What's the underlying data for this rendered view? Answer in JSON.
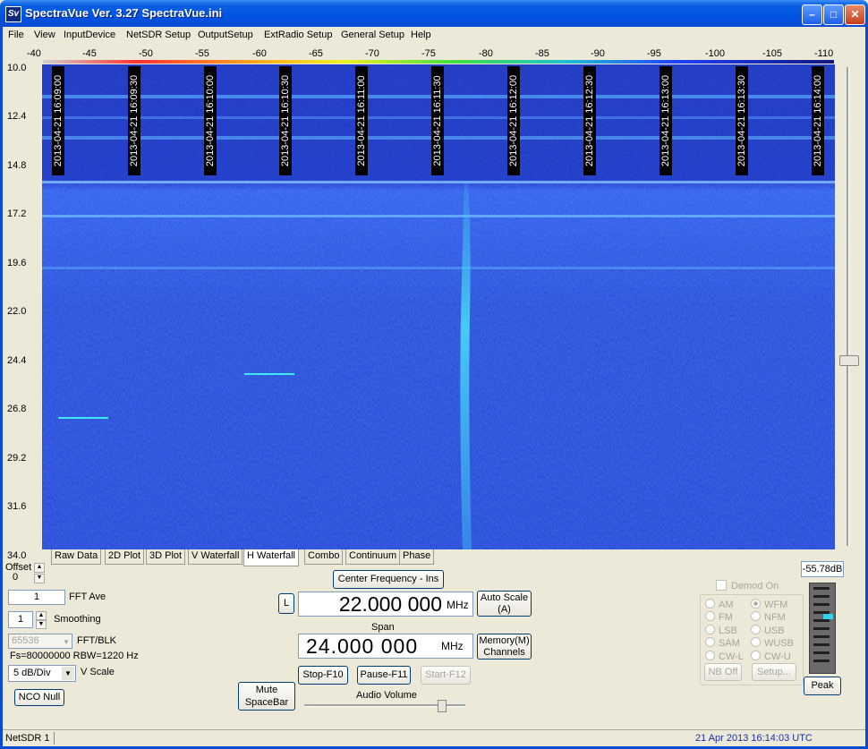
{
  "window": {
    "title": "SpectraVue Ver. 3.27  SpectraVue.ini",
    "icon_text": "Sv"
  },
  "menu": [
    "File",
    "View",
    "InputDevice",
    "NetSDR Setup",
    "OutputSetup",
    "ExtRadio Setup",
    "General Setup",
    "Help"
  ],
  "db_scale": [
    "-40",
    "-45",
    "-50",
    "-55",
    "-60",
    "-65",
    "-70",
    "-75",
    "-80",
    "-85",
    "-90",
    "-95",
    "-100",
    "-105",
    "-110"
  ],
  "freq_axis": [
    "10.0",
    "12.4",
    "14.8",
    "17.2",
    "19.6",
    "22.0",
    "24.4",
    "26.8",
    "29.2",
    "31.6",
    "34.0"
  ],
  "timestamps": [
    "2013-04-21 16:09:00",
    "2013-04-21 16:09:30",
    "2013-04-21 16:10:00",
    "2013-04-21 16:10:30",
    "2013-04-21 16:11:00",
    "2013-04-21 16:11:30",
    "2013-04-21 16:12:00",
    "2013-04-21 16:12:30",
    "2013-04-21 16:13:00",
    "2013-04-21 16:13:30",
    "2013-04-21 16:14:00"
  ],
  "tabs": [
    "Raw Data",
    "2D Plot",
    "3D Plot",
    "V Waterfall",
    "H Waterfall",
    "Combo",
    "Continuum",
    "Phase"
  ],
  "active_tab": "H Waterfall",
  "left_panel": {
    "offset_label": "Offset",
    "offset_value": "0",
    "fft_ave_value": "1",
    "fft_ave_label": "FFT Ave",
    "smoothing_value": "1",
    "smoothing_label": "Smoothing",
    "fft_blk_value": "65536",
    "fft_blk_label": "FFT/BLK",
    "fs_info": "Fs=80000000 RBW=1220 Hz",
    "vscale_value": "5 dB/Div",
    "vscale_label": "V Scale",
    "nco_null": "NCO Null"
  },
  "center": {
    "center_freq_button": "Center Frequency - Ins",
    "l_button": "L",
    "center_freq": "22.000 000",
    "center_unit": "MHz",
    "auto_scale": "Auto Scale\n(A)",
    "span_label": "Span",
    "span_freq": "24.000 000",
    "span_unit": "MHz",
    "memory": "Memory(M)\nChannels",
    "stop": "Stop-F10",
    "pause": "Pause-F11",
    "start": "Start-F12",
    "mute": "Mute\nSpaceBar",
    "audio_volume": "Audio Volume",
    "audio_volume_level": 0.85
  },
  "demod": {
    "demod_on": "Demod On",
    "modes_left": [
      "AM",
      "FM",
      "LSB",
      "SAM",
      "CW-L"
    ],
    "modes_right": [
      "WFM",
      "NFM",
      "USB",
      "WUSB",
      "CW-U"
    ],
    "selected": "WFM",
    "nb_off": "NB Off",
    "setup": "Setup..."
  },
  "meter": {
    "reading": "-55.78dB",
    "peak": "Peak",
    "level": 0.35
  },
  "status": {
    "left": "NetSDR 1",
    "right": "21 Apr 2013  16:14:03 UTC"
  },
  "colors": {
    "title_bar": "#0054e3",
    "waterfall_bg": "#1a3ad8",
    "signal": "#38c8f0",
    "status_date": "#1a2fa8"
  }
}
